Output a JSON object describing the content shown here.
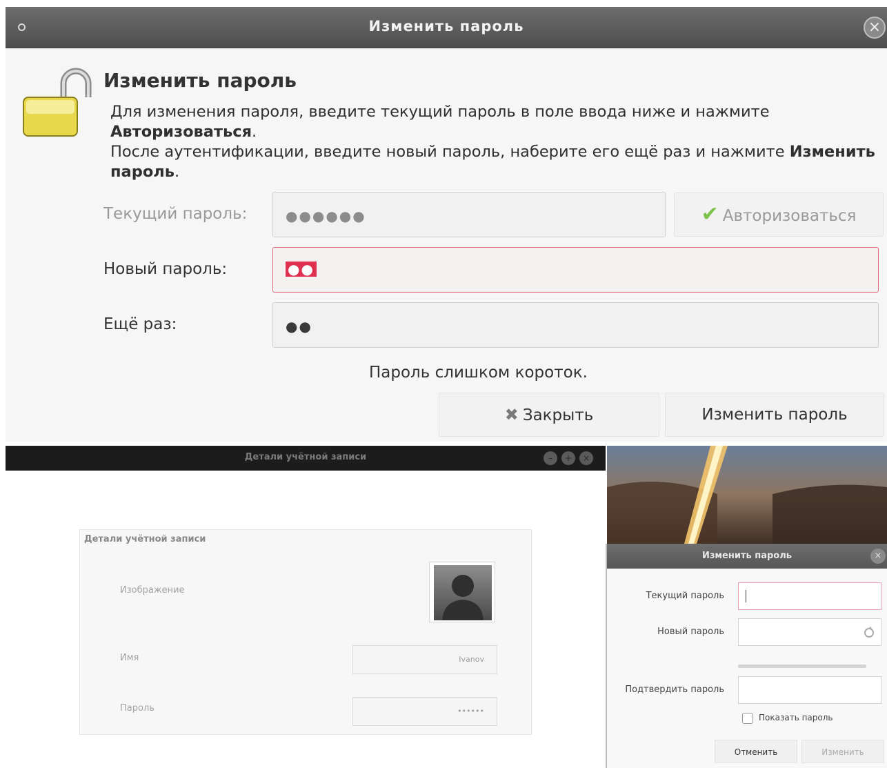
{
  "change_password_dialog": {
    "window_title": "Изменить пароль",
    "close_glyph": "×",
    "heading": "Изменить пароль",
    "desc": {
      "line1": "Для изменения пароля, введите текущий пароль в поле ввода ниже и нажмите",
      "line1_bold": "Авторизоваться",
      "line1_end": ".",
      "line2": "После аутентификации, введите новый пароль, наберите его ещё раз и нажмите",
      "line2_bold": "Изменить пароль",
      "line2_end": "."
    },
    "current_label": "Текущий пароль:",
    "current_value": "●●●●●●",
    "authorize_label": "Авторизоваться",
    "new_label": "Новый пароль:",
    "new_value": "●●",
    "repeat_label": "Ещё раз:",
    "repeat_value": "●●",
    "status_text": "Пароль слишком короток.",
    "close_label": "Закрыть",
    "change_label": "Изменить пароль",
    "colors": {
      "error_border": "#e0647a",
      "accent_check": "#7dc24a",
      "titlebar": "#5a5a5a"
    }
  },
  "account_details_window": {
    "window_title": "Детали учётной записи",
    "panel_title": "Детали учётной записи",
    "image_label": "Изображение",
    "name_label": "Имя",
    "name_value": "Ivanov",
    "password_label": "Пароль",
    "password_value": "••••••"
  },
  "small_change_password_dialog": {
    "window_title": "Изменить пароль",
    "current_label": "Текущий пароль",
    "new_label": "Новый пароль",
    "confirm_label": "Подтвердить пароль",
    "show_password_label": "Показать пароль",
    "cancel_label": "Отменить",
    "change_label": "Изменить"
  }
}
